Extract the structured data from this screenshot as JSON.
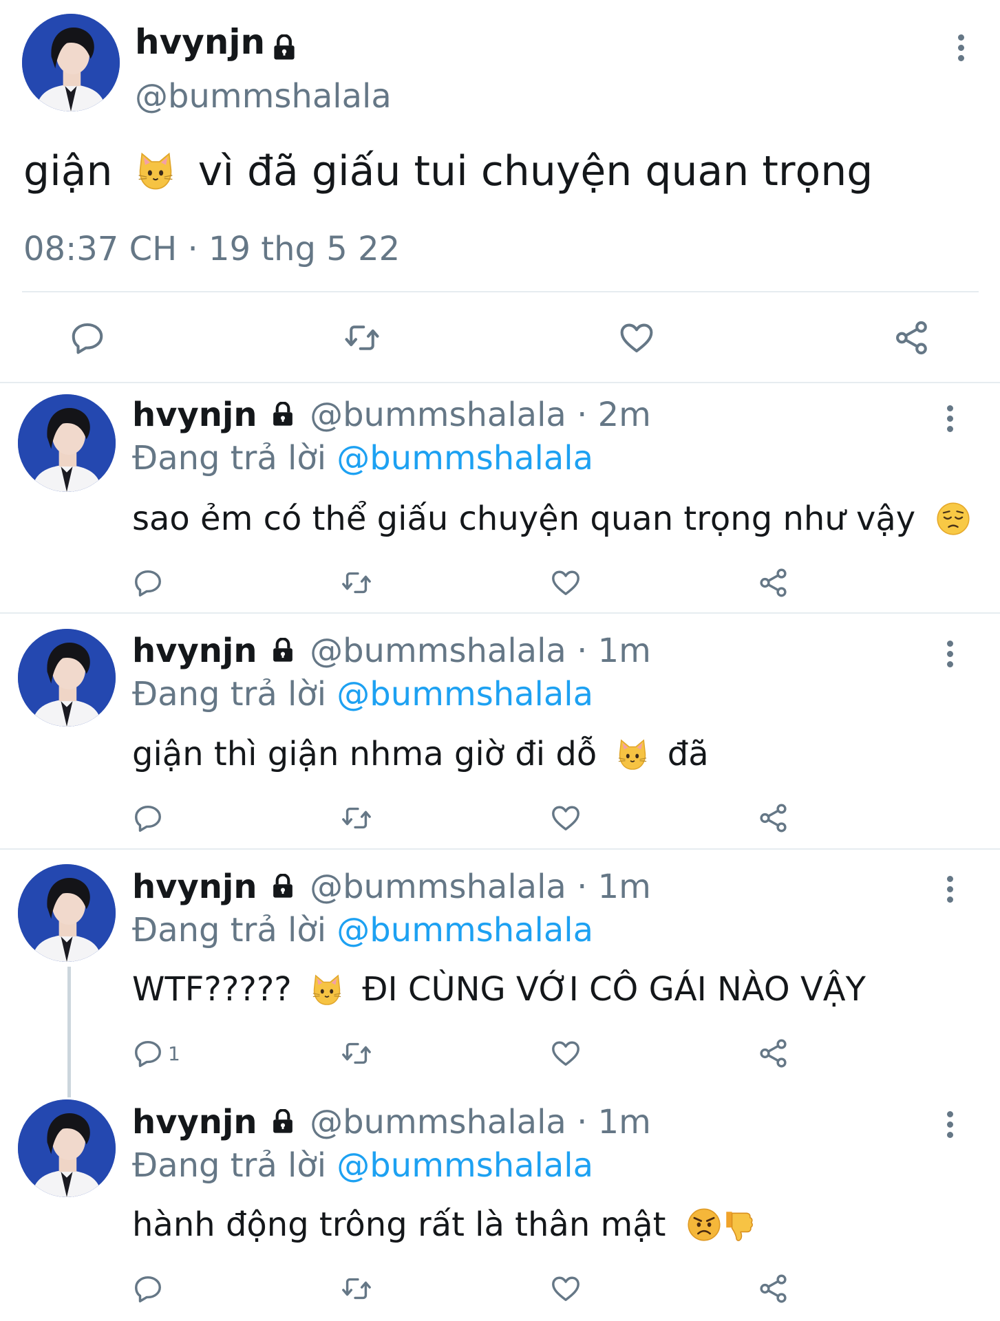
{
  "main_tweet": {
    "display_name": "hvynjn",
    "handle": "@bummshalala",
    "text_before": "giận",
    "text_after": "vì đã giấu tui chuyện quan trọng",
    "timestamp": "08:37 CH · 19 thg 5 22"
  },
  "replies": [
    {
      "display_name": "hvynjn",
      "meta": "@bummshalala · 2m",
      "replying_prefix": "Đang trả lời",
      "replying_to": "@bummshalala",
      "text": "sao ẻm có thể giấu chuyện quan trọng như vậy",
      "reply_count": ""
    },
    {
      "display_name": "hvynjn",
      "meta": "@bummshalala · 1m",
      "replying_prefix": "Đang trả lời",
      "replying_to": "@bummshalala",
      "text_before": "giận thì giận nhma giờ đi dỗ",
      "text_after": "đã",
      "reply_count": ""
    },
    {
      "display_name": "hvynjn",
      "meta": "@bummshalala · 1m",
      "replying_prefix": "Đang trả lời",
      "replying_to": "@bummshalala",
      "text_before": "WTF?????",
      "text_after": "ĐI CÙNG VỚI CÔ GÁI NÀO VẬY",
      "reply_count": "1"
    },
    {
      "display_name": "hvynjn",
      "meta": "@bummshalala · 1m",
      "replying_prefix": "Đang trả lời",
      "replying_to": "@bummshalala",
      "text": "hành động trông rất là thân mật",
      "reply_count": ""
    }
  ],
  "colors": {
    "accent_link": "#1da1f2",
    "muted": "#657786",
    "divider": "#e6ecf0"
  },
  "icons": [
    "lock-icon",
    "more-icon",
    "reply-icon",
    "retweet-icon",
    "like-icon",
    "share-icon",
    "cat-emoji",
    "pensive-emoji",
    "angry-emoji",
    "thumbs-down-emoji"
  ]
}
